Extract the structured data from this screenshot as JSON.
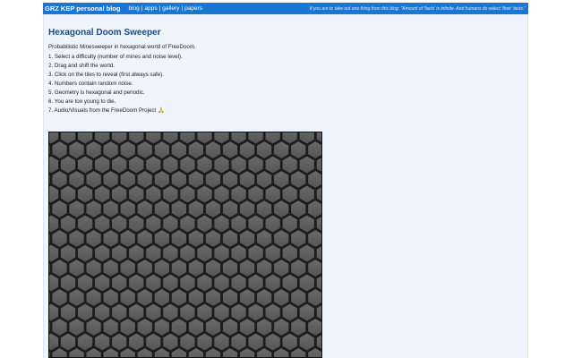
{
  "header": {
    "site_title": "GRZ KEP personal blog",
    "nav": [
      {
        "label": "blog"
      },
      {
        "label": "apps"
      },
      {
        "label": "gallery"
      },
      {
        "label": "papers"
      }
    ],
    "nav_separator": "|",
    "tagline": "If you are to take out one thing from this blog: \"Amount of 'facts' is infinite. And humans do select 'their' facts.\""
  },
  "post": {
    "title": "Hexagonal Doom Sweeper",
    "intro": "Probabilistic Minesweeper in hexagonal world of FreeDoom.",
    "steps": [
      "1. Select a difficulty (number of mines and noise level).",
      "2. Drag and shift the world.",
      "3. Click on the tiles to reveal (first always safe).",
      "4. Numbers contain random noise.",
      "5. Geometry is hexagonal and periodic.",
      "6. You are too young to die.",
      "7. Audio/Visuals from the FreeDoom Project 🙏"
    ]
  },
  "colors": {
    "header_bg": "#1976d2",
    "content_bg": "#eef5fd",
    "title_color": "#1a4a8a",
    "board_bg": "#2b2b2b",
    "tile_fill": "#555555",
    "tile_highlight": "#6a6a6a",
    "tile_stroke": "#1c1c1c"
  }
}
